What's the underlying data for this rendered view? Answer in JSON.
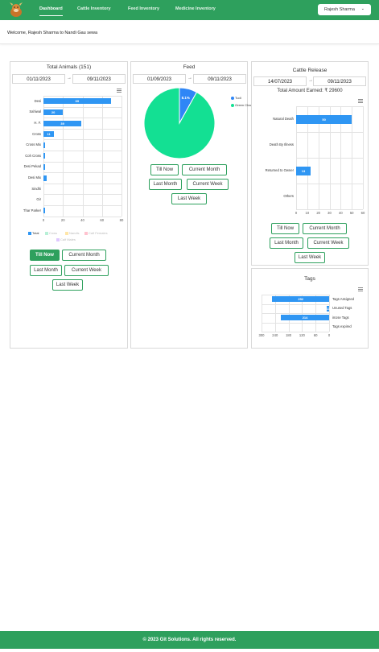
{
  "nav": {
    "links": [
      "Dashboard",
      "Cattle Inventory",
      "Feed Inventory",
      "Medicine Inventory"
    ],
    "user_label": "Rajesh Sharma"
  },
  "welcome": "Welcome, Rajesh Sharma to Nandi Gau sewa",
  "animals": {
    "title": "Total Animals (151)",
    "date_from": "01/11/2023",
    "date_to": "09/11/2023",
    "buttons": [
      "Till Now",
      "Current Month",
      "Last Month",
      "Current Week",
      "Last Week"
    ]
  },
  "feed": {
    "title": "Feed",
    "date_from": "01/09/2023",
    "date_to": "09/11/2023",
    "buttons": [
      "Till Now",
      "Current Month",
      "Last Month",
      "Current Week",
      "Last Week"
    ]
  },
  "release": {
    "title": "Cattle Release",
    "date_from": "14/07/2023",
    "date_to": "09/11/2023",
    "total_earned": "Total Amount Earned: ₹ 29600",
    "buttons": [
      "Till Now",
      "Current Month",
      "Last Month",
      "Current Week",
      "Last Week"
    ]
  },
  "tags": {
    "title": "Tags"
  },
  "footer": "© 2023 Git Solutions. All rights reserved.",
  "chart_data": [
    {
      "type": "bar",
      "orientation": "horizontal",
      "categories": [
        "Desi",
        "Sahiwal",
        "H. F.",
        "Cross",
        "Cross Mix",
        "Coh Cross",
        "Desi Pekad",
        "Desi Mix",
        "Sindhi",
        "Gir",
        "Thar Parker"
      ],
      "series": [
        {
          "name": "Total",
          "values": [
            69,
            20,
            39,
            11,
            1,
            1,
            2,
            3,
            0,
            0,
            2
          ],
          "color": "#2f96f3",
          "labels": [
            "69",
            "20",
            "39",
            "11",
            "",
            "",
            "",
            "",
            "",
            "",
            ""
          ]
        }
      ],
      "legend": [
        {
          "name": "Total",
          "color": "#2f96f3",
          "active": true
        },
        {
          "name": "Cows",
          "color": "#b8f0d7",
          "active": false
        },
        {
          "name": "Nandis",
          "color": "#ffe6a8",
          "active": false
        },
        {
          "name": "Calf Females",
          "color": "#ffc2cf",
          "active": false
        },
        {
          "name": "Calf Males",
          "color": "#dfc8ff",
          "active": false
        }
      ],
      "xlim": [
        0,
        80
      ],
      "xticks": [
        "0",
        "20",
        "40",
        "60",
        "80"
      ]
    },
    {
      "type": "pie",
      "slices": [
        {
          "name": "Tudi",
          "value": 8.1,
          "label": "8.1%",
          "color": "#2f86f6"
        },
        {
          "name": "Green Chara",
          "value": 91.9,
          "label": "91.9%",
          "color": "#13e093"
        }
      ]
    },
    {
      "type": "bar",
      "orientation": "horizontal",
      "categories": [
        "Natural Death",
        "Death By Illness",
        "Returned to Owner",
        "Others"
      ],
      "values": [
        50,
        0,
        13,
        0
      ],
      "labels": [
        "50",
        "",
        "13",
        ""
      ],
      "xlim": [
        0,
        60
      ],
      "xticks": [
        "0",
        "10",
        "20",
        "30",
        "40",
        "50",
        "60"
      ]
    },
    {
      "type": "bar",
      "orientation": "horizontal",
      "axis": "reversed",
      "categories": [
        "Tags Assigned",
        "Unused Tags",
        "inUse Tags",
        "Tags expired"
      ],
      "values": [
        252,
        11,
        214,
        0
      ],
      "labels": [
        "252",
        "11",
        "214",
        ""
      ],
      "xlim": [
        0,
        300
      ],
      "xticks": [
        "300",
        "240",
        "180",
        "120",
        "60",
        "0"
      ]
    }
  ]
}
